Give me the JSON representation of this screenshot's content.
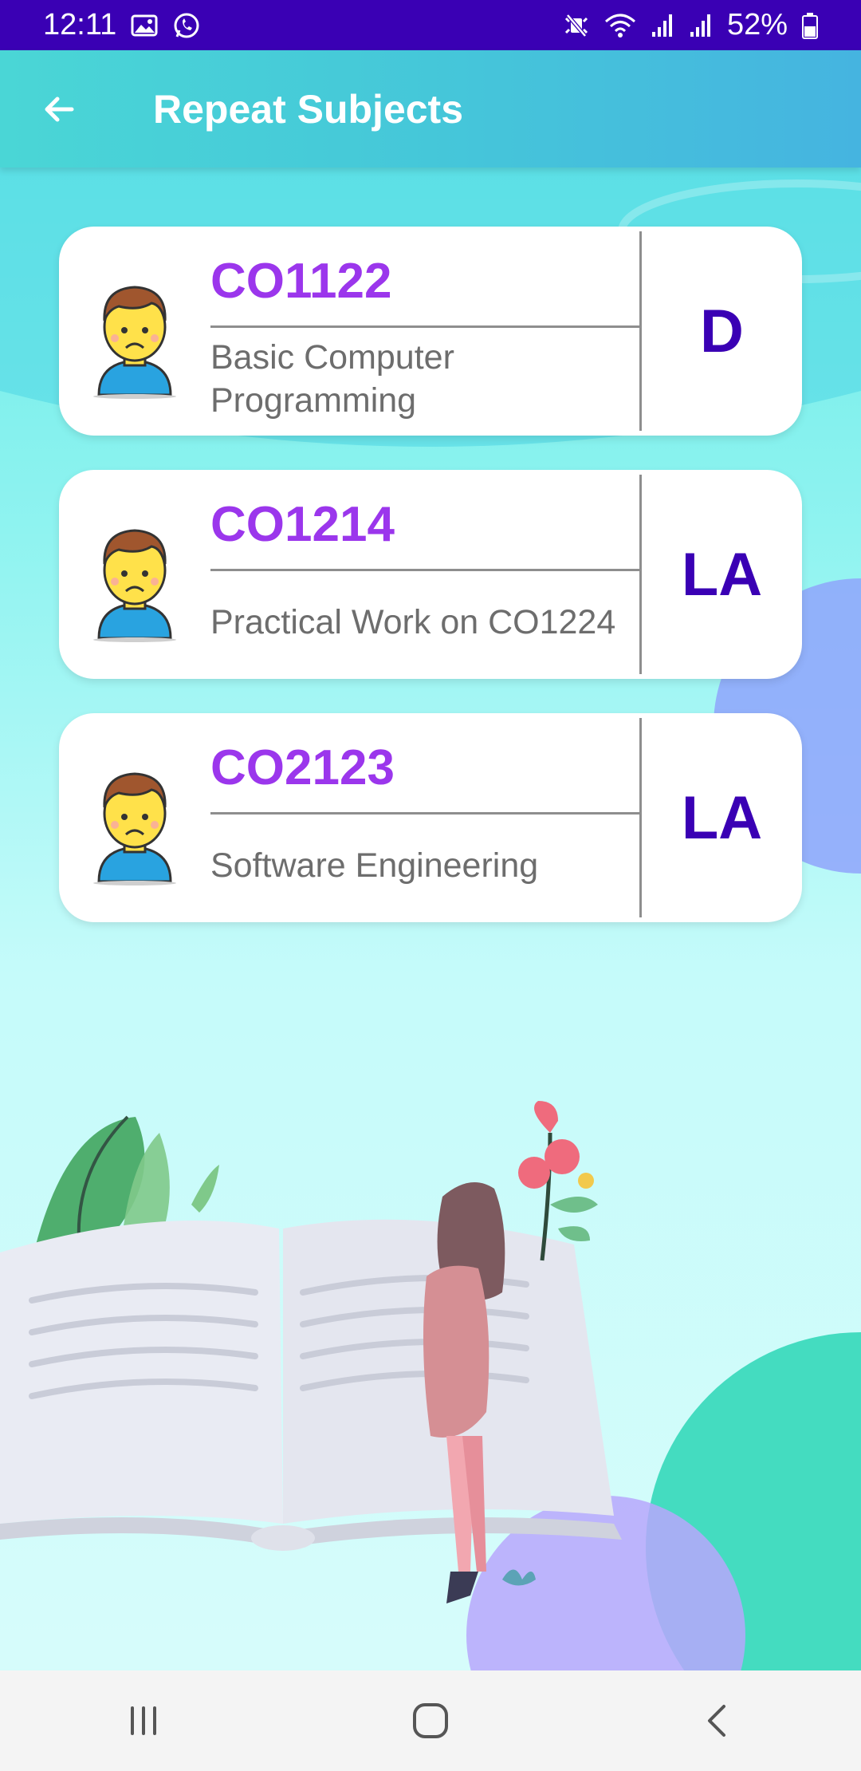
{
  "status_bar": {
    "time": "12:11",
    "battery": "52%",
    "icons_left": [
      "image-icon",
      "whatsapp-icon"
    ],
    "icons_right": [
      "mute-icon",
      "wifi-icon",
      "signal-icon",
      "signal-icon",
      "battery-icon"
    ]
  },
  "app_bar": {
    "title": "Repeat Subjects",
    "back_icon": "arrow-left-icon"
  },
  "subjects": [
    {
      "code": "CO1122",
      "name": "Basic Computer Programming",
      "grade": "D"
    },
    {
      "code": "CO1214",
      "name": "Practical Work on CO1224",
      "grade": "LA"
    },
    {
      "code": "CO2123",
      "name": "Software Engineering",
      "grade": "LA"
    }
  ],
  "nav_bar": {
    "buttons": [
      "recent-apps-icon",
      "home-icon",
      "back-icon"
    ]
  },
  "colors": {
    "status_bar": "#3a00b4",
    "accent_code": "#9b36ec",
    "grade": "#3a00b4",
    "app_bar": "#45c7d9"
  }
}
